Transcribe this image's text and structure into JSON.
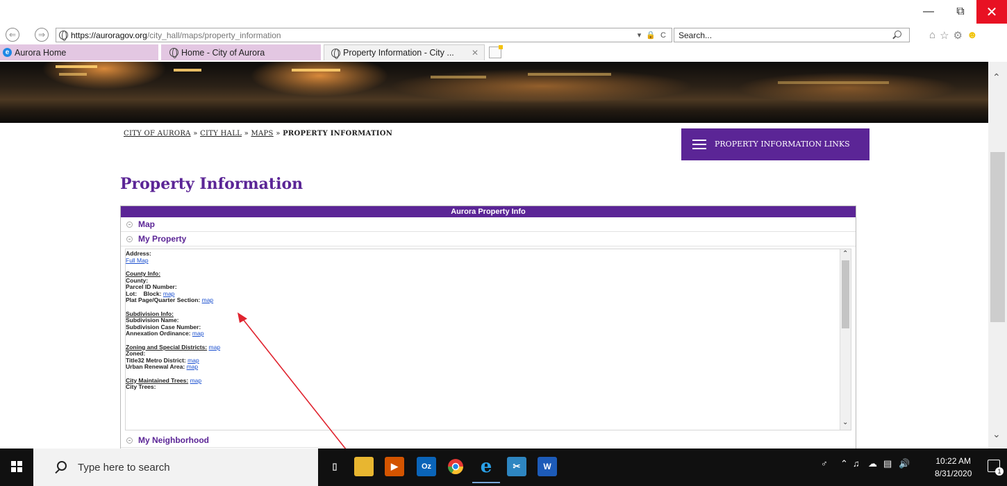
{
  "browser": {
    "url_host": "https://auroragov.org",
    "url_path": "/city_hall/maps/property_information",
    "search_placeholder": "Search...",
    "tabs": [
      {
        "label": "Aurora Home"
      },
      {
        "label": "Home - City of Aurora"
      },
      {
        "label": "Property Information - City ..."
      }
    ]
  },
  "breadcrumb": {
    "items": [
      "CITY OF AURORA",
      "CITY HALL",
      "MAPS"
    ],
    "separator": "»",
    "current": "PROPERTY INFORMATION"
  },
  "links_button": {
    "label": "PROPERTY INFORMATION LINKS"
  },
  "page": {
    "title": "Property Information"
  },
  "widget": {
    "header": "Aurora Property Info",
    "accordion": [
      "Map",
      "My Property",
      "My Neighborhood"
    ],
    "address_label": "Address:",
    "full_map": "Full Map",
    "county": {
      "heading": "County Info:",
      "county": "County:",
      "parcel": "Parcel ID Number:",
      "lot_block": "Lot:    Block:",
      "plat": "Plat Page/Quarter Section:"
    },
    "subdivision": {
      "heading": "Subdivision Info:",
      "name": "Subdivision Name:",
      "case": "Subdivision Case Number:",
      "annexation": "Annexation Ordinance:"
    },
    "zoning": {
      "heading": "Zoning and Special Districts:",
      "zoned": "Zoned:",
      "title32": "Title32 Metro District:",
      "urban": "Urban Renewal Area:"
    },
    "trees": {
      "heading": "City Maintained Trees:",
      "city_trees": "City Trees:"
    },
    "map_link": "map"
  },
  "taskbar": {
    "search_placeholder": "Type here to search",
    "time": "10:22 AM",
    "date": "8/31/2020"
  },
  "colors": {
    "brand_purple": "#5b2596",
    "tab_pink": "#e3c7e2",
    "link_blue": "#1a4fcf",
    "annotation_red": "#e0242f"
  }
}
